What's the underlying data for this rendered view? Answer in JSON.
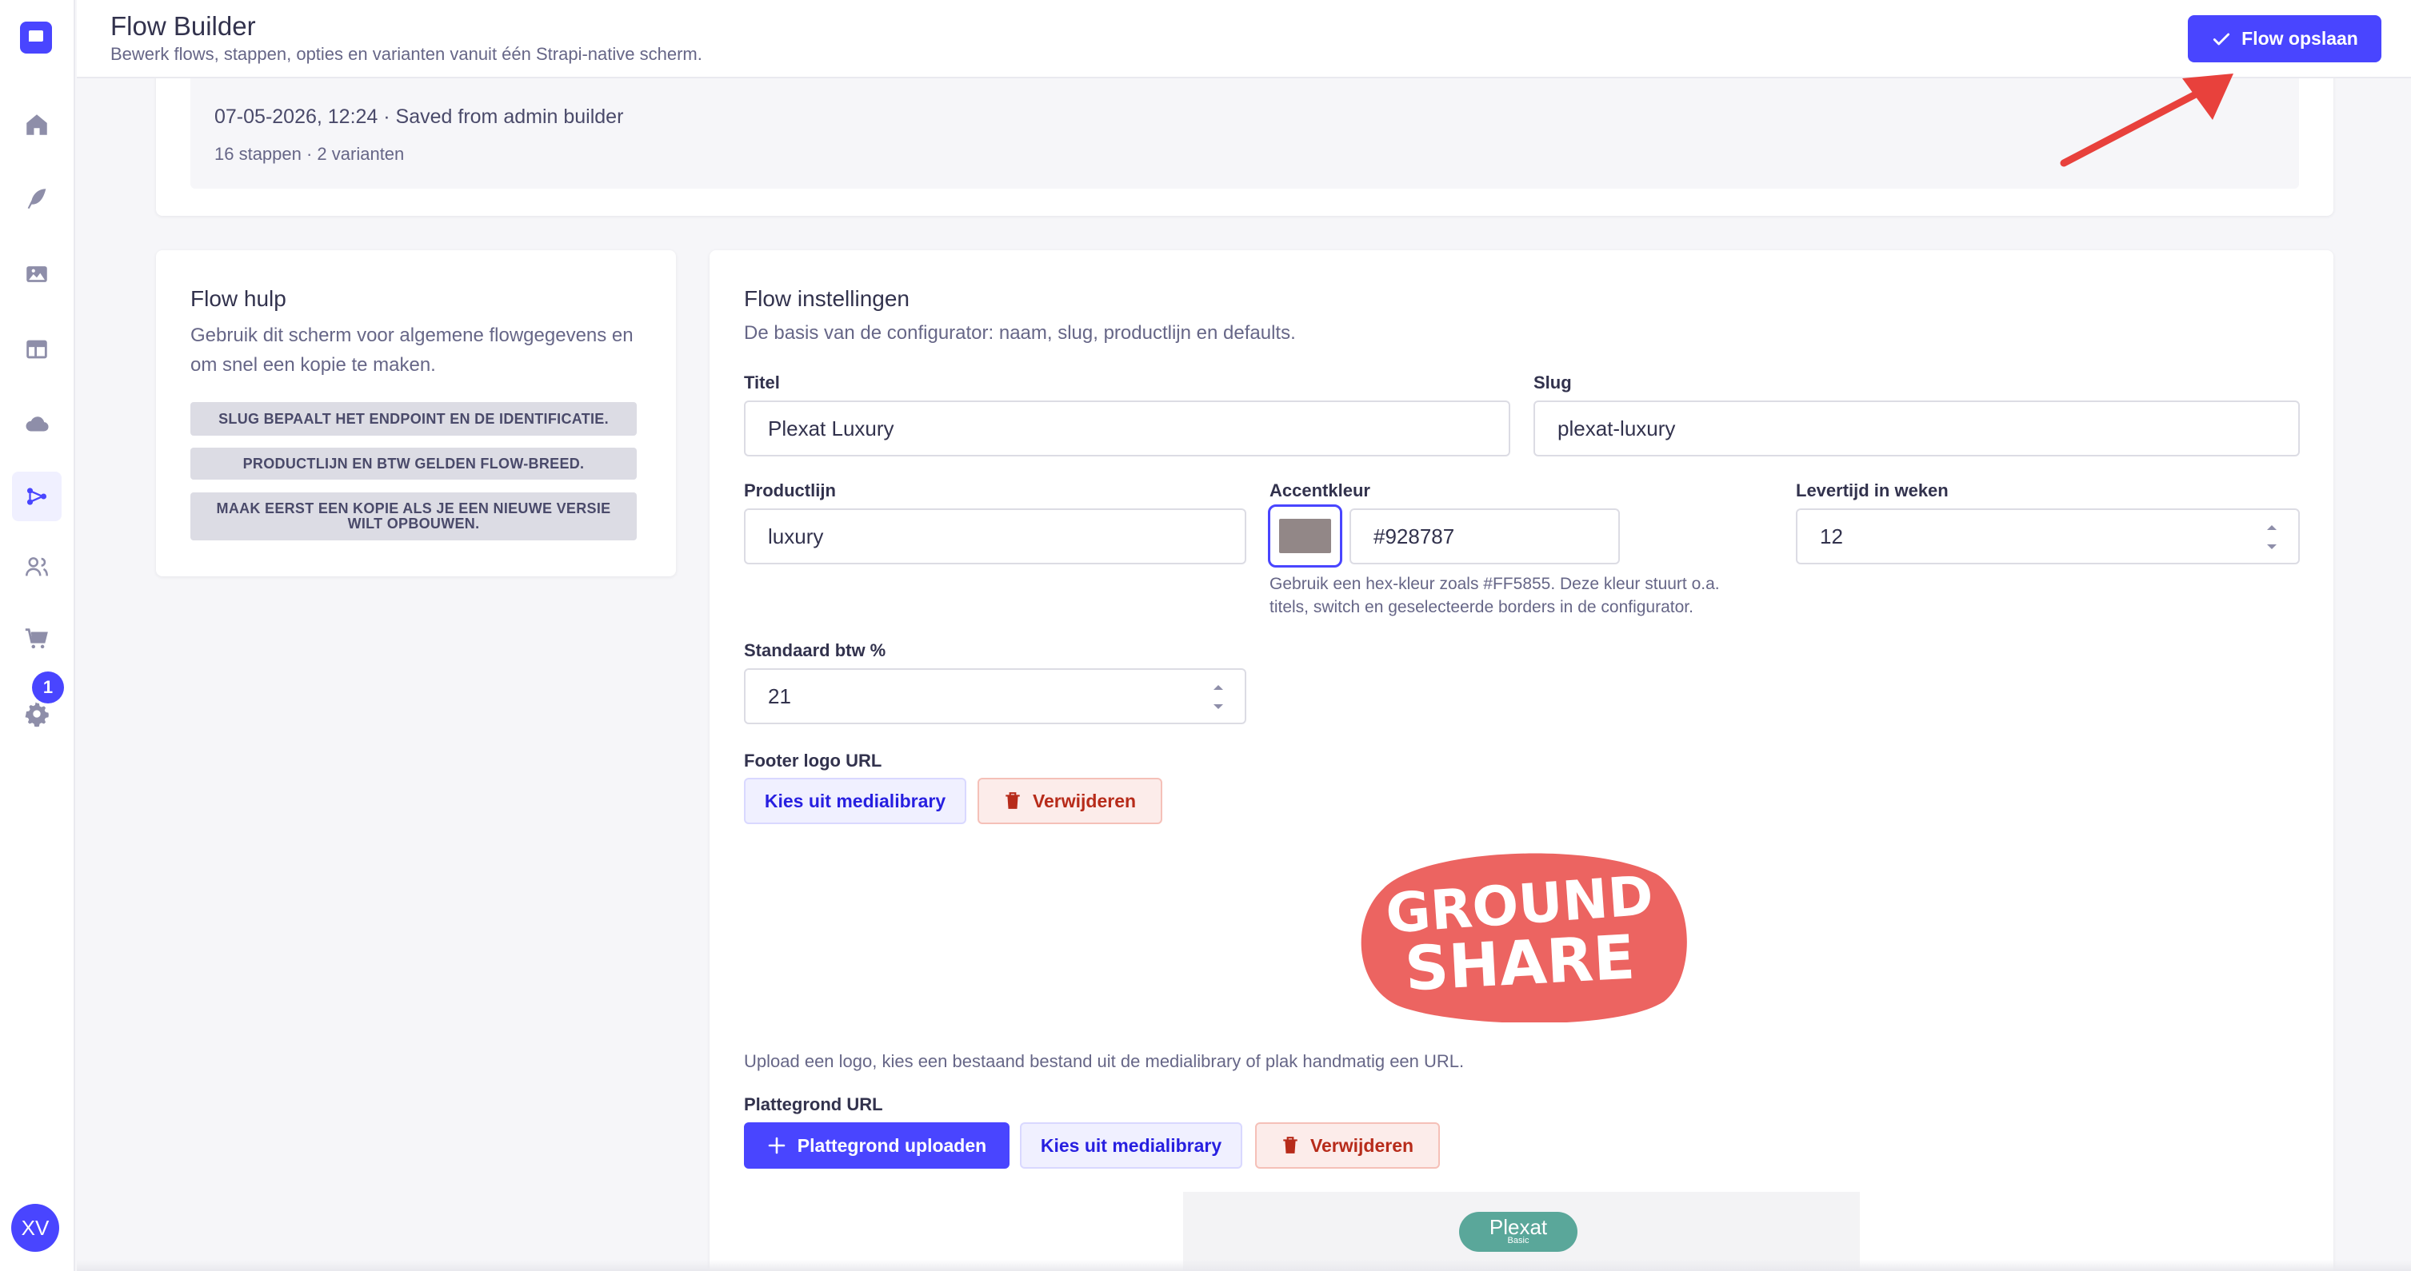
{
  "header": {
    "title": "Flow Builder",
    "subtitle": "Bewerk flows, stappen, opties en varianten vanuit één Strapi-native scherm.",
    "save_label": "Flow opslaan"
  },
  "nav": {
    "badge_count": "1",
    "avatar_initials": "XV"
  },
  "top_card": {
    "date_line": "07-05-2026, 12:24 · Saved from admin builder",
    "meta_line": "16 stappen · 2 varianten"
  },
  "help": {
    "title": "Flow hulp",
    "description": "Gebruik dit scherm voor algemene flowgegevens en om snel een kopie te maken.",
    "tags": [
      "Slug bepaalt het endpoint en de identificatie.",
      "Productlijn en btw gelden flow-breed.",
      "Maak eerst een kopie als je een nieuwe versie wilt opbouwen."
    ]
  },
  "settings": {
    "title": "Flow instellingen",
    "description": "De basis van de configurator: naam, slug, productlijn en defaults.",
    "fields": {
      "titel": {
        "label": "Titel",
        "value": "Plexat Luxury"
      },
      "slug": {
        "label": "Slug",
        "value": "plexat-luxury"
      },
      "productlijn": {
        "label": "Productlijn",
        "value": "luxury"
      },
      "accentkleur": {
        "label": "Accentkleur",
        "value": "#928787",
        "hint_line1": "Gebruik een hex-kleur zoals #FF5855. Deze kleur stuurt o.a.",
        "hint_line2": "titels, switch en geselecteerde borders in de configurator."
      },
      "levertijd": {
        "label": "Levertijd in weken",
        "value": "12"
      },
      "btw": {
        "label": "Standaard btw %",
        "value": "21"
      }
    },
    "footer_logo": {
      "label": "Footer logo URL",
      "choose_label": "Kies uit medialibrary",
      "remove_label": "Verwijderen",
      "hint": "Upload een logo, kies een bestaand bestand uit de medialibrary of plak handmatig een URL.",
      "logo_text_line1": "GROUND",
      "logo_text_line2": "SHARE"
    },
    "plattegrond": {
      "label": "Plattegrond URL",
      "upload_label": "Plattegrond uploaden",
      "choose_label": "Kies uit medialibrary",
      "remove_label": "Verwijderen",
      "preview_brand": "Plexat",
      "preview_sub": "Basic"
    }
  },
  "colors": {
    "primary": "#4945ff",
    "accent_swatch": "#928787",
    "danger": "#b72b1a",
    "logo_red": "#ec6461"
  }
}
